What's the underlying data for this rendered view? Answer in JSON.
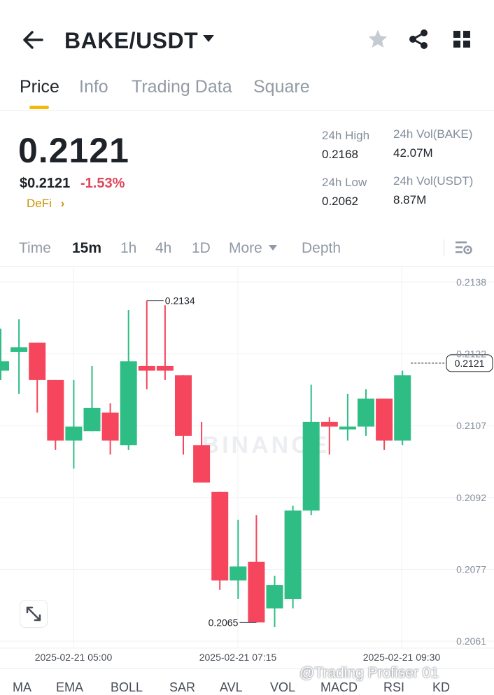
{
  "header": {
    "pair": "BAKE/USDT",
    "icons": [
      "back-arrow-icon",
      "caret-down-icon",
      "star-icon",
      "share-icon",
      "grid-icon"
    ]
  },
  "tabs": [
    "Price",
    "Info",
    "Trading Data",
    "Square"
  ],
  "active_tab": "Price",
  "ticker": {
    "last_price": "0.2121",
    "usd_price": "$0.2121",
    "change": "-1.53%",
    "tag": "DeFi",
    "high_label": "24h High",
    "high": "0.2168",
    "low_label": "24h Low",
    "low": "0.2062",
    "vol_base_label": "24h Vol(BAKE)",
    "vol_base": "42.07M",
    "vol_quote_label": "24h Vol(USDT)",
    "vol_quote": "8.87M"
  },
  "intervals": {
    "time": "Time",
    "m15": "15m",
    "h1": "1h",
    "h4": "4h",
    "d1": "1D",
    "more": "More",
    "depth": "Depth"
  },
  "colors": {
    "up": "#2ebd85",
    "down": "#f6465d",
    "accent": "#f0b90b",
    "defi": "#c99400"
  },
  "chart_data": {
    "type": "candlestick",
    "y_ticks": [
      "0.2138",
      "0.2122",
      "0.2107",
      "0.2092",
      "0.2077",
      "0.2061"
    ],
    "x_ticks": [
      "2025-02-21 05:00",
      "2025-02-21 07:15",
      "2025-02-21 09:30"
    ],
    "current_price_label": "0.2121",
    "high_marker": "0.2134",
    "low_marker": "0.2065",
    "watermark": "BINANCE",
    "ylim": [
      0.2061,
      0.2138
    ],
    "candles": [
      {
        "o": 0.2119,
        "c": 0.2121,
        "h": 0.2128,
        "l": 0.2117
      },
      {
        "o": 0.2123,
        "c": 0.2124,
        "h": 0.213,
        "l": 0.2114
      },
      {
        "o": 0.2125,
        "c": 0.2117,
        "h": 0.2125,
        "l": 0.211
      },
      {
        "o": 0.2117,
        "c": 0.2104,
        "h": 0.2117,
        "l": 0.2102
      },
      {
        "o": 0.2104,
        "c": 0.2107,
        "h": 0.2117,
        "l": 0.2098
      },
      {
        "o": 0.2106,
        "c": 0.2111,
        "h": 0.212,
        "l": 0.2106
      },
      {
        "o": 0.211,
        "c": 0.2104,
        "h": 0.2112,
        "l": 0.2101
      },
      {
        "o": 0.2103,
        "c": 0.2121,
        "h": 0.2132,
        "l": 0.2102
      },
      {
        "o": 0.212,
        "c": 0.2119,
        "h": 0.2134,
        "l": 0.2115
      },
      {
        "o": 0.212,
        "c": 0.2119,
        "h": 0.2133,
        "l": 0.2117
      },
      {
        "o": 0.2118,
        "c": 0.2105,
        "h": 0.2118,
        "l": 0.2101
      },
      {
        "o": 0.2103,
        "c": 0.2095,
        "h": 0.2108,
        "l": 0.2095
      },
      {
        "o": 0.2093,
        "c": 0.2074,
        "h": 0.2093,
        "l": 0.2072
      },
      {
        "o": 0.2074,
        "c": 0.2077,
        "h": 0.2087,
        "l": 0.207
      },
      {
        "o": 0.2078,
        "c": 0.2065,
        "h": 0.2088,
        "l": 0.2065
      },
      {
        "o": 0.2068,
        "c": 0.2073,
        "h": 0.2075,
        "l": 0.2064
      },
      {
        "o": 0.207,
        "c": 0.2089,
        "h": 0.209,
        "l": 0.2068
      },
      {
        "o": 0.2089,
        "c": 0.2108,
        "h": 0.2116,
        "l": 0.2088
      },
      {
        "o": 0.2108,
        "c": 0.2107,
        "h": 0.2109,
        "l": 0.2101
      },
      {
        "o": 0.2107,
        "c": 0.2107,
        "h": 0.2114,
        "l": 0.2104
      },
      {
        "o": 0.2107,
        "c": 0.2113,
        "h": 0.2115,
        "l": 0.2105
      },
      {
        "o": 0.2113,
        "c": 0.2104,
        "h": 0.2113,
        "l": 0.2102
      },
      {
        "o": 0.2104,
        "c": 0.2118,
        "h": 0.2119,
        "l": 0.2103
      }
    ]
  },
  "indicators": [
    "MA",
    "EMA",
    "BOLL",
    "SAR",
    "AVL",
    "VOL",
    "MACD",
    "RSI",
    "KD"
  ],
  "overlay_user": "@Trading Profiser 01"
}
